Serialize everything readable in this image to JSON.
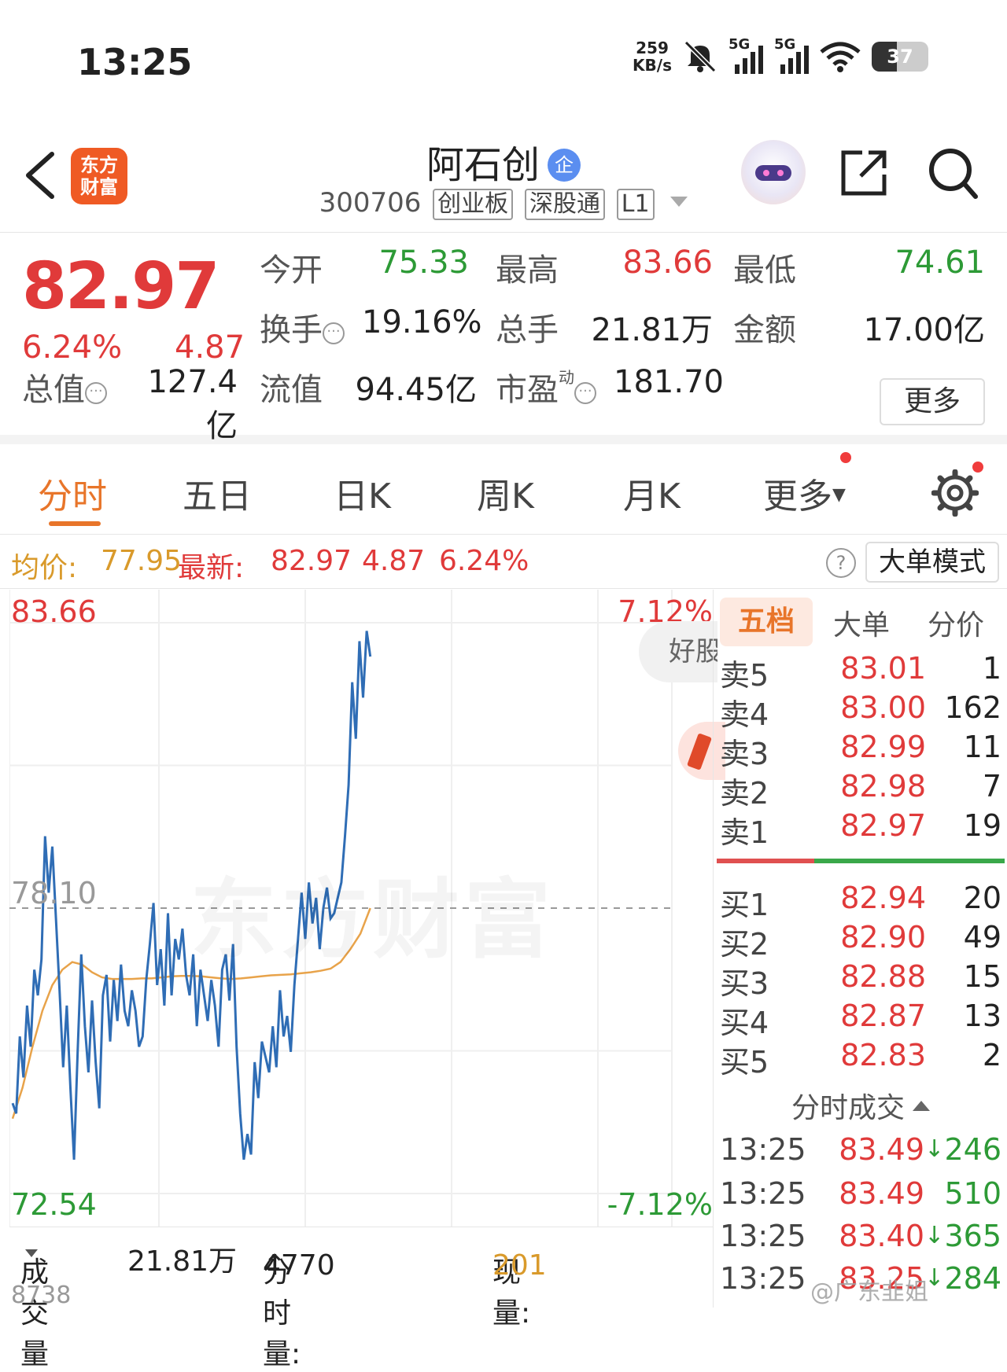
{
  "status_bar": {
    "time": "13:25",
    "net_speed_value": "259",
    "net_speed_unit": "KB/s",
    "signal_1_tag": "5G",
    "signal_2_tag": "5G",
    "battery": "37"
  },
  "header": {
    "logo_line1": "东方",
    "logo_line2": "财富",
    "stock_name": "阿石创",
    "name_badge": "企",
    "code": "300706",
    "tags": [
      "创业板",
      "深股通",
      "L1"
    ]
  },
  "quote": {
    "price": "82.97",
    "change_pct": "6.24%",
    "change_amt": "4.87",
    "open_label": "今开",
    "open": "75.33",
    "high_label": "最高",
    "high": "83.66",
    "low_label": "最低",
    "low": "74.61",
    "turnover_label": "换手",
    "turnover": "19.16%",
    "volume_label": "总手",
    "volume": "21.81万",
    "amount_label": "金额",
    "amount": "17.00亿",
    "mktcap_label": "总值",
    "mktcap": "127.4亿",
    "float_label": "流值",
    "float_cap": "94.45亿",
    "pe_label": "市盈",
    "pe_sup": "动",
    "pe": "181.70",
    "more_button": "更多"
  },
  "tabs": [
    "分时",
    "五日",
    "日K",
    "周K",
    "月K",
    "更多"
  ],
  "info_row": {
    "avg_label": "均价:",
    "avg": "77.95",
    "latest_label": "最新:",
    "latest": "82.97",
    "chg": "4.87",
    "pct": "6.24%",
    "help": "?",
    "big_order_mode": "大单模式"
  },
  "chart_data": {
    "type": "line",
    "ylim": [
      72.54,
      83.66
    ],
    "y_top_label": "83.66",
    "y_bottom_label": "72.54",
    "y_mid_label": "78.10",
    "right_top_label": "7.12%",
    "right_bottom_label": "-7.12%",
    "reference_price": 78.1,
    "series": [
      {
        "name": "price",
        "color": "#2f6db5",
        "values": [
          74.3,
          74.1,
          75.6,
          74.8,
          76.2,
          75.4,
          76.9,
          76.4,
          77.1,
          79.5,
          78.4,
          79.3,
          77.9,
          76.5,
          75.0,
          76.2,
          74.6,
          73.2,
          75.3,
          77.2,
          75.8,
          74.9,
          76.3,
          75.1,
          74.2,
          76.4,
          76.8,
          75.5,
          76.7,
          75.9,
          77.0,
          76.1,
          75.8,
          76.5,
          76.1,
          75.4,
          75.6,
          76.7,
          77.4,
          78.2,
          76.6,
          77.3,
          76.2,
          78.0,
          76.4,
          77.5,
          77.1,
          77.7,
          76.8,
          76.4,
          77.2,
          75.8,
          76.9,
          76.4,
          75.9,
          76.7,
          76.2,
          75.4,
          76.9,
          77.2,
          76.3,
          77.4,
          75.4,
          74.1,
          73.2,
          73.7,
          73.3,
          75.1,
          74.4,
          75.5,
          75.2,
          74.9,
          75.8,
          75.0,
          76.5,
          75.6,
          76.0,
          75.3,
          76.6,
          77.5,
          78.4,
          77.5,
          78.6,
          77.8,
          78.3,
          77.3,
          78.1,
          78.5,
          77.9,
          78.0,
          78.3,
          78.6,
          79.5,
          80.5,
          82.5,
          81.4,
          83.3,
          82.2,
          83.5,
          83.0
        ]
      },
      {
        "name": "avg",
        "color": "#e8a34a",
        "values": [
          74.0,
          74.6,
          75.4,
          76.1,
          76.6,
          76.9,
          77.05,
          77.0,
          76.85,
          76.75,
          76.72,
          76.72,
          76.72,
          76.73,
          76.73,
          76.75,
          76.77,
          76.78,
          76.78,
          76.77,
          76.75,
          76.73,
          76.72,
          76.73,
          76.75,
          76.77,
          76.79,
          76.8,
          76.81,
          76.83,
          76.85,
          76.88,
          76.92,
          77.05,
          77.3,
          77.6,
          78.1
        ]
      }
    ]
  },
  "overlays": {
    "good_stock": "好股",
    "watermark": "东方财富"
  },
  "volume_bar": {
    "label": "成交量",
    "total": "21.81万",
    "period_label": "分时量:",
    "period": "4770",
    "period_arrow": "↑",
    "now_label": "现量:",
    "now": "201",
    "axis_label": "8738"
  },
  "order_book": {
    "tabs": [
      "五档",
      "大单",
      "分价"
    ],
    "asks": [
      {
        "label": "卖5",
        "price": "83.01",
        "qty": "1"
      },
      {
        "label": "卖4",
        "price": "83.00",
        "qty": "162"
      },
      {
        "label": "卖3",
        "price": "82.99",
        "qty": "11"
      },
      {
        "label": "卖2",
        "price": "82.98",
        "qty": "7"
      },
      {
        "label": "卖1",
        "price": "82.97",
        "qty": "19"
      }
    ],
    "bids": [
      {
        "label": "买1",
        "price": "82.94",
        "qty": "20"
      },
      {
        "label": "买2",
        "price": "82.90",
        "qty": "49"
      },
      {
        "label": "买3",
        "price": "82.88",
        "qty": "15"
      },
      {
        "label": "买4",
        "price": "82.87",
        "qty": "13"
      },
      {
        "label": "买5",
        "price": "82.83",
        "qty": "2"
      }
    ],
    "ticks_header": "分时成交",
    "ticks": [
      {
        "time": "13:25",
        "price": "83.49",
        "arrow": "↓",
        "vol": "246"
      },
      {
        "time": "13:25",
        "price": "83.49",
        "arrow": "",
        "vol": "510"
      },
      {
        "time": "13:25",
        "price": "83.40",
        "arrow": "↓",
        "vol": "365"
      },
      {
        "time": "13:25",
        "price": "83.25",
        "arrow": "↓",
        "vol": "284"
      }
    ]
  },
  "watermark_text": "@广东韭姐"
}
